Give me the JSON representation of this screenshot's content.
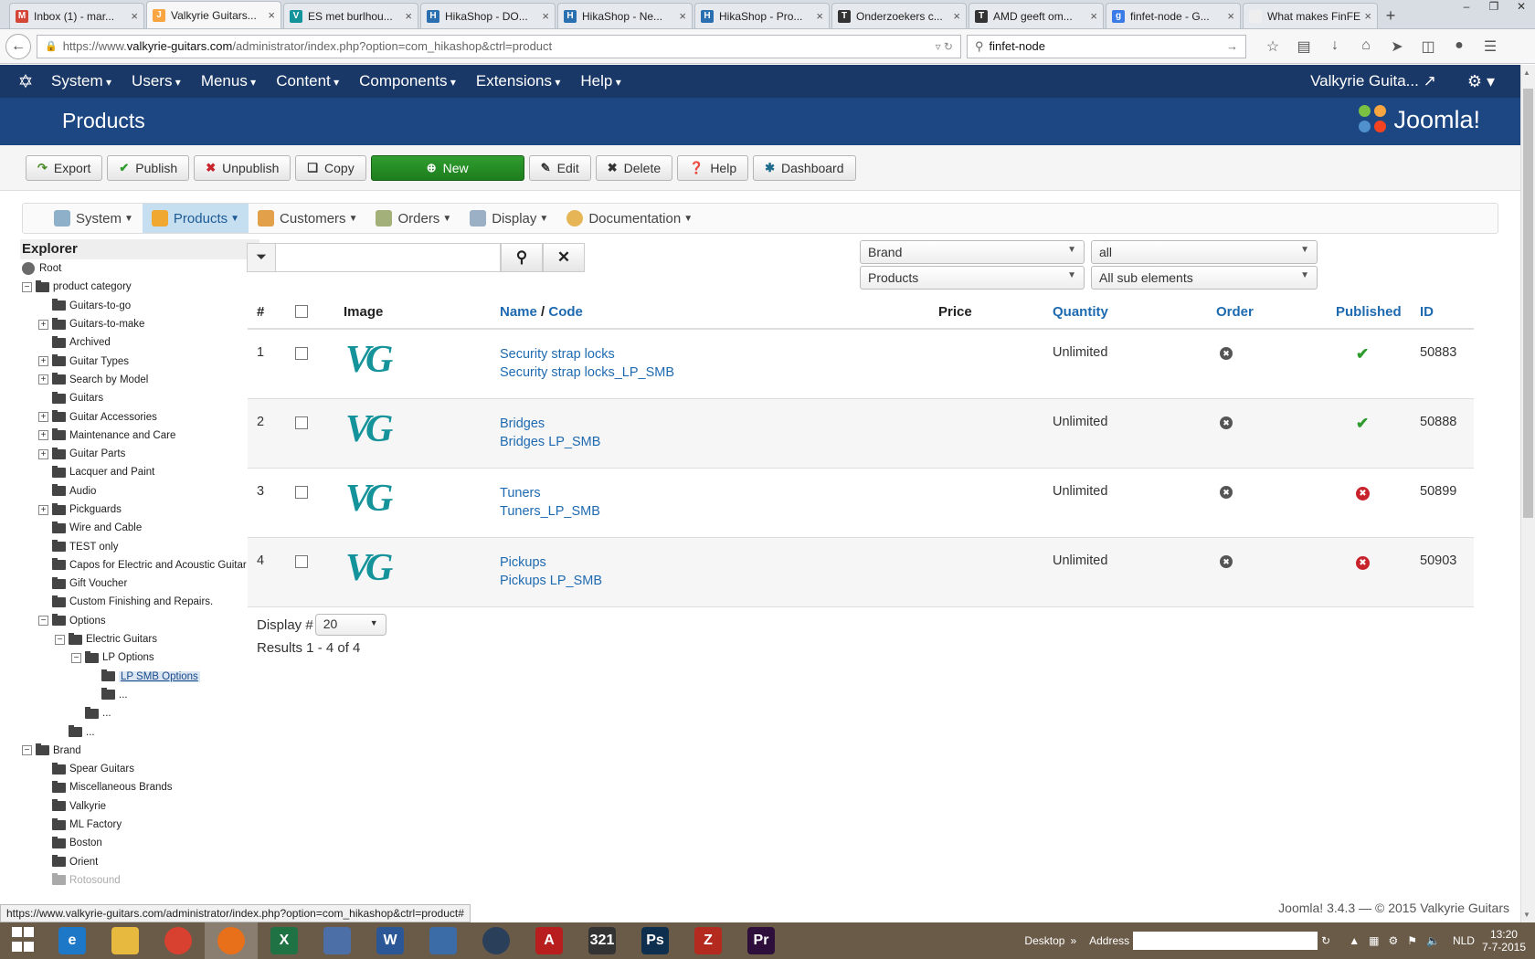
{
  "browser": {
    "tabs": [
      {
        "title": "Inbox (1) - mar...",
        "fav": "M",
        "color": "#d44638"
      },
      {
        "title": "Valkyrie Guitars...",
        "fav": "J",
        "color": "#f9a541",
        "active": true
      },
      {
        "title": "ES met burlhou...",
        "fav": "V",
        "color": "#15939a"
      },
      {
        "title": "HikaShop - DO...",
        "fav": "H",
        "color": "#2a6fb0"
      },
      {
        "title": "HikaShop - Ne...",
        "fav": "H",
        "color": "#2a6fb0"
      },
      {
        "title": "HikaShop - Pro...",
        "fav": "H",
        "color": "#2a6fb0"
      },
      {
        "title": "Onderzoekers c...",
        "fav": "T",
        "color": "#333"
      },
      {
        "title": "AMD geeft om...",
        "fav": "T",
        "color": "#333"
      },
      {
        "title": "finfet-node - G...",
        "fav": "g",
        "color": "#3b7be8"
      },
      {
        "title": "What makes FinFET...",
        "fav": "",
        "color": "#eee"
      }
    ],
    "url_prefix": "https://www.",
    "url_host": "valkyrie-guitars.com",
    "url_path": "/administrator/index.php?option=com_hikashop&ctrl=product",
    "search_value": "finfet-node"
  },
  "joomla": {
    "menu": [
      "System",
      "Users",
      "Menus",
      "Content",
      "Components",
      "Extensions",
      "Help"
    ],
    "site_name": "Valkyrie Guita...",
    "page_title": "Products",
    "brand": "Joomla!",
    "toolbar": {
      "export": "Export",
      "publish": "Publish",
      "unpublish": "Unpublish",
      "copy": "Copy",
      "new": "New",
      "edit": "Edit",
      "delete": "Delete",
      "help": "Help",
      "dashboard": "Dashboard"
    }
  },
  "hika_menu": {
    "system": "System",
    "products": "Products",
    "customers": "Customers",
    "orders": "Orders",
    "display": "Display",
    "documentation": "Documentation"
  },
  "explorer": {
    "title": "Explorer",
    "items": [
      {
        "label": "Root",
        "indent": 0,
        "toggle": "",
        "icon": "globe"
      },
      {
        "label": "product category",
        "indent": 0,
        "toggle": "-",
        "icon": "open"
      },
      {
        "label": "Guitars-to-go",
        "indent": 2,
        "toggle": "",
        "icon": "folder"
      },
      {
        "label": "Guitars-to-make",
        "indent": 2,
        "toggle": "+",
        "icon": "folder"
      },
      {
        "label": "Archived",
        "indent": 2,
        "toggle": "",
        "icon": "folder"
      },
      {
        "label": "Guitar Types",
        "indent": 2,
        "toggle": "+",
        "icon": "folder"
      },
      {
        "label": "Search by Model",
        "indent": 2,
        "toggle": "+",
        "icon": "folder"
      },
      {
        "label": "Guitars",
        "indent": 2,
        "toggle": "",
        "icon": "folder"
      },
      {
        "label": "Guitar Accessories",
        "indent": 2,
        "toggle": "+",
        "icon": "folder"
      },
      {
        "label": "Maintenance and Care",
        "indent": 2,
        "toggle": "+",
        "icon": "folder"
      },
      {
        "label": "Guitar Parts",
        "indent": 2,
        "toggle": "+",
        "icon": "folder"
      },
      {
        "label": "Lacquer and Paint",
        "indent": 2,
        "toggle": "",
        "icon": "folder"
      },
      {
        "label": "Audio",
        "indent": 2,
        "toggle": "",
        "icon": "folder"
      },
      {
        "label": "Pickguards",
        "indent": 2,
        "toggle": "+",
        "icon": "folder"
      },
      {
        "label": "Wire and Cable",
        "indent": 2,
        "toggle": "",
        "icon": "folder"
      },
      {
        "label": "TEST only",
        "indent": 2,
        "toggle": "",
        "icon": "folder"
      },
      {
        "label": "Capos for Electric and Acoustic Guitar",
        "indent": 2,
        "toggle": "",
        "icon": "folder"
      },
      {
        "label": "Gift Voucher",
        "indent": 2,
        "toggle": "",
        "icon": "folder"
      },
      {
        "label": "Custom Finishing and Repairs.",
        "indent": 2,
        "toggle": "",
        "icon": "folder"
      },
      {
        "label": "Options",
        "indent": 2,
        "toggle": "-",
        "icon": "open"
      },
      {
        "label": "Electric Guitars",
        "indent": 4,
        "toggle": "-",
        "icon": "open"
      },
      {
        "label": "LP Options",
        "indent": 6,
        "toggle": "-",
        "icon": "open"
      },
      {
        "label": "LP SMB Options",
        "indent": 8,
        "toggle": "",
        "icon": "folder",
        "selected": true
      },
      {
        "label": "...",
        "indent": 8,
        "toggle": "",
        "icon": "folder"
      },
      {
        "label": "...",
        "indent": 6,
        "toggle": "",
        "icon": "folder"
      },
      {
        "label": "...",
        "indent": 4,
        "toggle": "",
        "icon": "folder"
      },
      {
        "label": "Brand",
        "indent": 0,
        "toggle": "-",
        "icon": "open"
      },
      {
        "label": "Spear Guitars",
        "indent": 2,
        "toggle": "",
        "icon": "folder"
      },
      {
        "label": "Miscellaneous Brands",
        "indent": 2,
        "toggle": "",
        "icon": "folder"
      },
      {
        "label": "Valkyrie",
        "indent": 2,
        "toggle": "",
        "icon": "folder"
      },
      {
        "label": "ML Factory",
        "indent": 2,
        "toggle": "",
        "icon": "folder"
      },
      {
        "label": "Boston",
        "indent": 2,
        "toggle": "",
        "icon": "folder"
      },
      {
        "label": "Orient",
        "indent": 2,
        "toggle": "",
        "icon": "folder"
      },
      {
        "label": "Rotosound",
        "indent": 2,
        "toggle": "",
        "icon": "folder",
        "faded": true
      }
    ]
  },
  "filters": {
    "search_value": "",
    "brand": "Brand",
    "all": "all",
    "products": "Products",
    "sub": "All sub elements"
  },
  "table": {
    "headers": {
      "num": "#",
      "image": "Image",
      "name": "Name",
      "slash": " / ",
      "code": "Code",
      "price": "Price",
      "quantity": "Quantity",
      "order": "Order",
      "published": "Published",
      "id": "ID"
    },
    "image_logo": "VG",
    "rows": [
      {
        "num": "1",
        "name": "Security strap locks",
        "code": "Security strap locks_LP_SMB",
        "price": "",
        "quantity": "Unlimited",
        "published": true,
        "id": "50883"
      },
      {
        "num": "2",
        "name": "Bridges",
        "code": "Bridges LP_SMB",
        "price": "",
        "quantity": "Unlimited",
        "published": true,
        "id": "50888"
      },
      {
        "num": "3",
        "name": "Tuners",
        "code": "Tuners_LP_SMB",
        "price": "",
        "quantity": "Unlimited",
        "published": false,
        "id": "50899"
      },
      {
        "num": "4",
        "name": "Pickups",
        "code": "Pickups LP_SMB",
        "price": "",
        "quantity": "Unlimited",
        "published": false,
        "id": "50903"
      }
    ]
  },
  "pagination": {
    "display_label": "Display #",
    "display_value": "20",
    "results": "Results 1 - 4 of 4"
  },
  "footer": "Joomla! 3.4.3  —  © 2015 Valkyrie Guitars",
  "status_url": "https://www.valkyrie-guitars.com/administrator/index.php?option=com_hikashop&ctrl=product#",
  "taskbar": {
    "desktop": "Desktop",
    "address": "Address",
    "lang": "NLD",
    "time": "13:20",
    "date": "7-7-2015",
    "apps": [
      {
        "name": "ie",
        "glyph": "e",
        "color": "#1e78c8"
      },
      {
        "name": "explorer",
        "glyph": "",
        "color": "#e7b93f"
      },
      {
        "name": "chrome",
        "glyph": "",
        "color": "#d8402f"
      },
      {
        "name": "firefox",
        "glyph": "",
        "color": "#e8701a",
        "active": true
      },
      {
        "name": "excel",
        "glyph": "X",
        "color": "#1f7244"
      },
      {
        "name": "pen",
        "glyph": "",
        "color": "#4d6fa8"
      },
      {
        "name": "word",
        "glyph": "W",
        "color": "#2b5797"
      },
      {
        "name": "mail",
        "glyph": "",
        "color": "#3c6ca8"
      },
      {
        "name": "steam",
        "glyph": "",
        "color": "#2a3f5a"
      },
      {
        "name": "acrobat",
        "glyph": "A",
        "color": "#b81e1e"
      },
      {
        "name": "media",
        "glyph": "321",
        "color": "#333"
      },
      {
        "name": "photoshop",
        "glyph": "Ps",
        "color": "#0f2f4f"
      },
      {
        "name": "filezilla",
        "glyph": "Z",
        "color": "#b52a1e"
      },
      {
        "name": "premiere",
        "glyph": "Pr",
        "color": "#2e0f3b"
      }
    ]
  }
}
